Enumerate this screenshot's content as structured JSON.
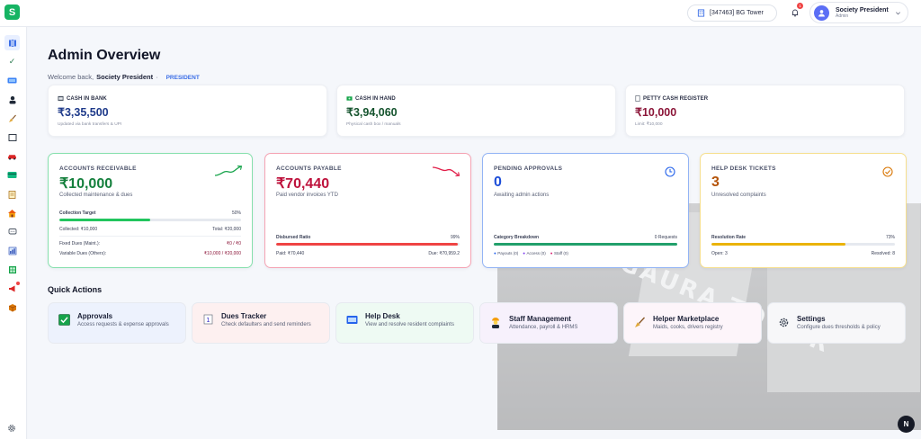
{
  "header": {
    "logo_letter": "S",
    "society": "[347463] BG Tower",
    "notification_count": "1",
    "user_name": "Society President",
    "user_role": "Admin"
  },
  "page": {
    "title": "Admin Overview",
    "welcome_prefix": "Welcome back,",
    "welcome_name": "Society President",
    "welcome_sep": "·",
    "role_tag": "PRESIDENT"
  },
  "cash_cards": [
    {
      "label": "CASH IN BANK",
      "amount": "₹3,35,500",
      "sub": "Updated via bank transfers & UPI",
      "color": "#1e3a8a"
    },
    {
      "label": "CASH IN HAND",
      "amount": "₹3,94,060",
      "sub": "Physical cash box / manuals",
      "color": "#14532d"
    },
    {
      "label": "PETTY CASH REGISTER",
      "amount": "₹10,000",
      "sub": "Limit: ₹10,000",
      "color": "#8b1538"
    }
  ],
  "receivable": {
    "title": "ACCOUNTS RECEIVABLE",
    "value": "₹10,000",
    "desc": "Collected maintenance & dues",
    "target_label": "Collection Target",
    "target_pct": "50%",
    "progress": 0.5,
    "collected": "Collected: ₹10,000",
    "total": "Total: ₹20,000",
    "fixed_label": "Fixed Dues (Maint.):",
    "fixed_value": "₹0 / ₹0",
    "variable_label": "Variable Dues (Others):",
    "variable_value": "₹10,000 / ₹20,000",
    "color": "#16a34a"
  },
  "payable": {
    "title": "ACCOUNTS PAYABLE",
    "value": "₹70,440",
    "desc": "Paid vendor invoices YTD",
    "ratio_label": "Disbursed Ratio",
    "ratio_pct": "99%",
    "progress": 0.99,
    "paid": "Paid: ₹70,440",
    "due": "Due: ₹70,959.2",
    "color": "#e11d48"
  },
  "approvals": {
    "title": "PENDING APPROVALS",
    "value": "0",
    "desc": "Awaiting admin actions",
    "breakdown_label": "Category Breakdown",
    "breakdown_value": "0 Requests",
    "legend": [
      "Payouts (0)",
      "Access (0)",
      "Staff (0)"
    ],
    "color": "#2563eb"
  },
  "helpdesk": {
    "title": "HELP DESK TICKETS",
    "value": "3",
    "desc": "Unresolved complaints",
    "rate_label": "Resolution Rate",
    "rate_pct": "73%",
    "progress": 0.73,
    "open": "Open: 3",
    "resolved": "Resolved: 8",
    "color": "#d97706"
  },
  "quick_actions": {
    "title": "Quick Actions",
    "items": [
      {
        "name": "Approvals",
        "desc": "Access requests & expense approvals",
        "icon": "check-box-icon"
      },
      {
        "name": "Dues Tracker",
        "desc": "Check defaulters and send reminders",
        "icon": "ledger-icon"
      },
      {
        "name": "Help Desk",
        "desc": "View and resolve resident complaints",
        "icon": "ticket-icon"
      },
      {
        "name": "Staff Management",
        "desc": "Attendance, payroll & HRMS",
        "icon": "worker-icon"
      },
      {
        "name": "Helper Marketplace",
        "desc": "Maids, cooks, drivers registry",
        "icon": "broom-icon"
      },
      {
        "name": "Settings",
        "desc": "Configure dues thresholds & policy",
        "icon": "gear-icon"
      }
    ]
  },
  "background": {
    "building_text": "BHAGAURA TOWER"
  },
  "help_fab": "N"
}
